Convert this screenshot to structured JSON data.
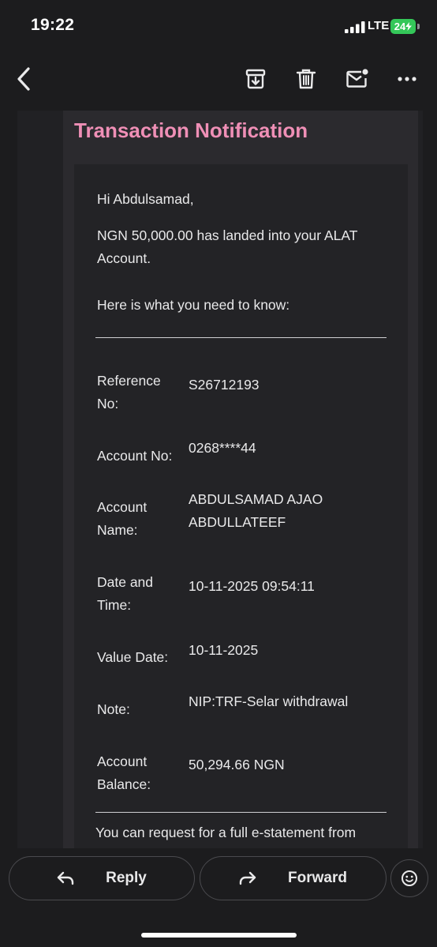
{
  "status_bar": {
    "time": "19:22",
    "network": "LTE",
    "battery": "24"
  },
  "toolbar": {
    "back_icon": "chevron-left-icon",
    "archive_icon": "archive-icon",
    "delete_icon": "trash-icon",
    "mark_unread_icon": "mail-unread-icon",
    "more_icon": "more-horizontal-icon"
  },
  "email": {
    "title": "Transaction Notification",
    "greeting": "Hi Abdulsamad,",
    "message_line1": "NGN 50,000.00 has landed into your ALAT",
    "message_line2": "Account.",
    "intro": "Here is what you need to know:",
    "details": [
      {
        "label_lines": [
          "Reference",
          "No:"
        ],
        "value_lines": [
          "S26712193"
        ]
      },
      {
        "label_lines": [
          "Account No:"
        ],
        "value_lines": [
          "0268****44"
        ]
      },
      {
        "label_lines": [
          "Account",
          "Name:"
        ],
        "value_lines": [
          "ABDULSAMAD AJAO",
          "ABDULLATEEF"
        ]
      },
      {
        "label_lines": [
          "Date and",
          "Time:"
        ],
        "value_lines": [
          "10-11-2025 09:54:11"
        ]
      },
      {
        "label_lines": [
          "Value Date:"
        ],
        "value_lines": [
          "10-11-2025"
        ]
      },
      {
        "label_lines": [
          "Note:"
        ],
        "value_lines": [
          "NIP:TRF-Selar withdrawal"
        ]
      },
      {
        "label_lines": [
          "Account",
          "Balance:"
        ],
        "value_lines": [
          "50,294.66 NGN"
        ]
      }
    ],
    "footer": "You can request for a full e-statement from"
  },
  "actions": {
    "reply_label": "Reply",
    "forward_label": "Forward",
    "emoji_icon": "smiley-icon"
  },
  "colors": {
    "title_pink": "#ef8fb6",
    "background": "#1c1c1e",
    "battery_green": "#34c759"
  }
}
